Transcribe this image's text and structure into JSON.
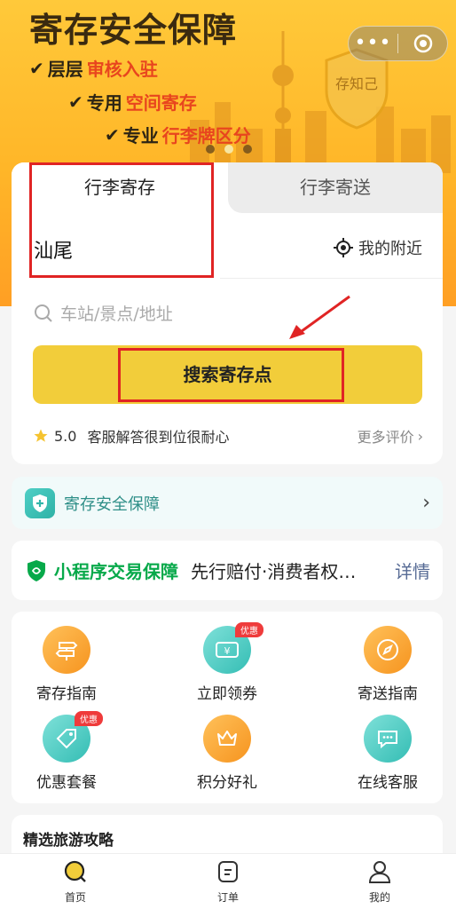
{
  "banner": {
    "title": "寄存安全保障",
    "lines": [
      {
        "pre": "层层",
        "hl": "审核入驻",
        "post": ""
      },
      {
        "pre": "专用",
        "hl": "空间寄存",
        "post": ""
      },
      {
        "pre": "专业",
        "hl": "行李牌区分",
        "post": ""
      }
    ],
    "badge_text": "存知己"
  },
  "capsule": {
    "more": "•••"
  },
  "tabs": {
    "active": "行李寄存",
    "inactive": "行李寄送"
  },
  "location": {
    "city": "汕尾",
    "nearby": "我的附近"
  },
  "search": {
    "placeholder": "车站/景点/地址",
    "button": "搜索寄存点"
  },
  "rating": {
    "score": "5.0",
    "comment": "客服解答很到位很耐心",
    "more": "更多评价"
  },
  "security": {
    "label": "寄存安全保障"
  },
  "guarantee": {
    "title": "小程序交易保障",
    "desc": "先行赔付·消费者权…",
    "link": "详情"
  },
  "services": [
    {
      "label": "寄存指南",
      "icon": "signpost-icon",
      "tag": ""
    },
    {
      "label": "立即领券",
      "icon": "coupon-icon",
      "tag": "优惠"
    },
    {
      "label": "寄送指南",
      "icon": "compass-icon",
      "tag": ""
    },
    {
      "label": "优惠套餐",
      "icon": "price-tag-icon",
      "tag": "优惠"
    },
    {
      "label": "积分好礼",
      "icon": "crown-icon",
      "tag": ""
    },
    {
      "label": "在线客服",
      "icon": "chat-icon",
      "tag": ""
    }
  ],
  "tips": {
    "title": "精选旅游攻略"
  },
  "nav": {
    "home": "首页",
    "orders": "订单",
    "mine": "我的"
  },
  "colors": {
    "accent": "#f2cd3a",
    "banner": "#ffb628",
    "annotation": "#e02424",
    "guarantee_green": "#07a94a"
  }
}
